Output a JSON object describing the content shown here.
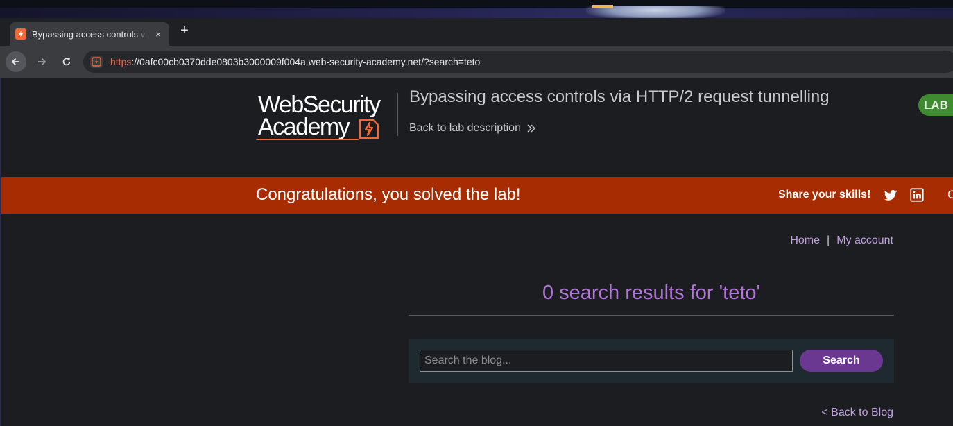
{
  "browser": {
    "tab_title": "Bypassing access controls via HTTP/2 request tunnelling",
    "tab_close": "×",
    "new_tab": "+",
    "url_scheme": "https",
    "url_rest": "://0afc00cb0370dde0803b3000009f004a.web-security-academy.net/?search=teto"
  },
  "header": {
    "logo_line1": "WebSecurity",
    "logo_line2": "Academy",
    "lab_title": "Bypassing access controls via HTTP/2 request tunnelling",
    "back_to_lab": "Back to lab description",
    "status_badge": "LAB"
  },
  "banner": {
    "message": "Congratulations, you solved the lab!",
    "share": "Share your skills!",
    "continue_partial": "C"
  },
  "nav": {
    "home": "Home",
    "separator": "|",
    "my_account": "My account"
  },
  "search": {
    "results_heading": "0 search results for 'teto'",
    "placeholder": "Search the blog...",
    "value": "",
    "button": "Search"
  },
  "footer": {
    "back_to_blog": "< Back to Blog"
  },
  "icons": {
    "favicon": "portswigger-bolt-icon",
    "back": "arrow-left-icon",
    "forward": "arrow-right-icon",
    "reload": "reload-icon",
    "twitter": "twitter-icon",
    "linkedin": "linkedin-icon"
  },
  "colors": {
    "banner": "#a82c02",
    "accent_purple": "#b075d6",
    "button_purple": "#6a3890",
    "lab_badge": "#3e8c2f",
    "brand_orange": "#ef6a38"
  }
}
